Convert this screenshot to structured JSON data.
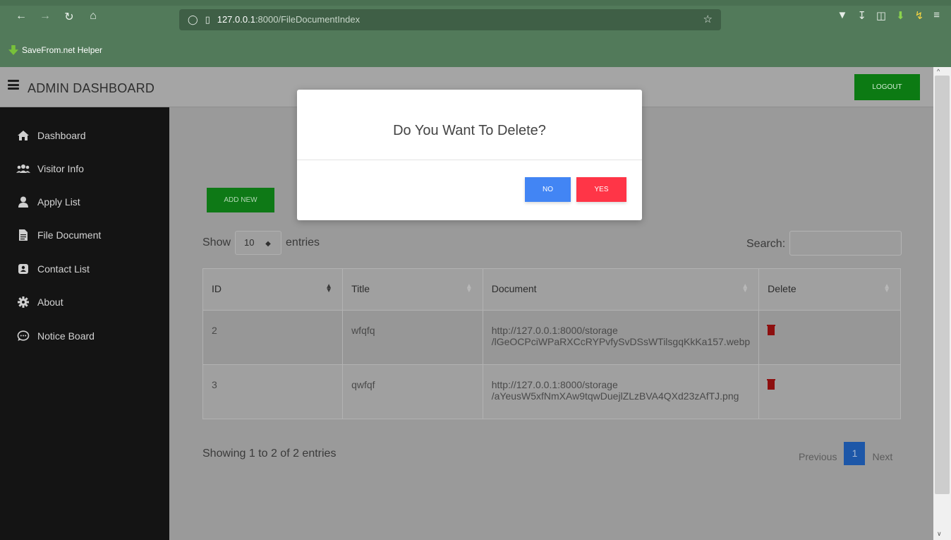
{
  "browser": {
    "url_host": "127.0.0.1",
    "url_path": ":8000/FileDocumentIndex",
    "bookmark_label": "SaveFrom.net Helper"
  },
  "header": {
    "title": "ADMIN DASHBOARD",
    "logout_label": "LOGOUT"
  },
  "sidebar": {
    "items": [
      {
        "label": "Dashboard",
        "icon": "home-icon"
      },
      {
        "label": "Visitor Info",
        "icon": "users-icon"
      },
      {
        "label": "Apply List",
        "icon": "user-icon"
      },
      {
        "label": "File Document",
        "icon": "file-icon"
      },
      {
        "label": "Contact List",
        "icon": "contact-icon"
      },
      {
        "label": "About",
        "icon": "gear-icon"
      },
      {
        "label": "Notice Board",
        "icon": "chat-icon"
      }
    ]
  },
  "main": {
    "add_new_label": "ADD NEW",
    "show_label": "Show",
    "entries_label": "entries",
    "page_size": "10",
    "search_label": "Search:",
    "columns": [
      "ID",
      "Title",
      "Document",
      "Delete"
    ],
    "rows": [
      {
        "id": "2",
        "title": "wfqfq",
        "doc_line1": "http://127.0.0.1:8000/storage",
        "doc_line2": "/lGeOCPciWPaRXCcRYPvfySvDSsWTilsgqKkKa157.webp"
      },
      {
        "id": "3",
        "title": "qwfqf",
        "doc_line1": "http://127.0.0.1:8000/storage",
        "doc_line2": "/aYeusW5xfNmXAw9tqwDuejlZLzBVA4QXd23zAfTJ.png"
      }
    ],
    "showing_text": "Showing 1 to 2 of 2 entries",
    "pager": {
      "previous": "Previous",
      "current": "1",
      "next": "Next"
    }
  },
  "modal": {
    "title": "Do You Want To Delete?",
    "no_label": "NO",
    "yes_label": "YES"
  },
  "colors": {
    "no_button": "#4285f4",
    "yes_button": "#ff3547",
    "add_new": "#0e7916",
    "logout": "#0c7a13",
    "sidebar_bg": "#141414"
  }
}
